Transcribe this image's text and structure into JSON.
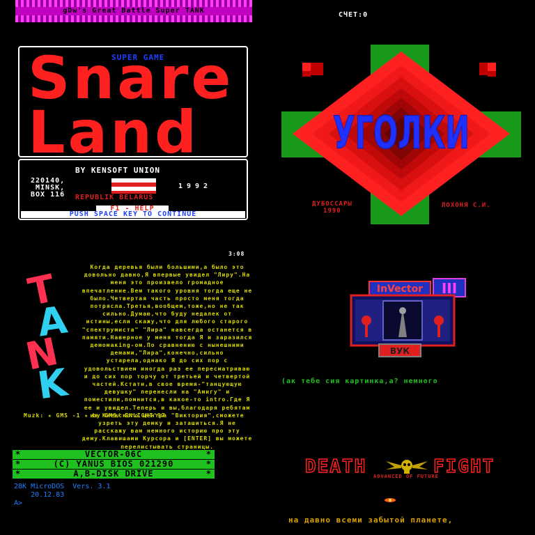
{
  "panel1": {
    "strip_title": "gDw's Great Battle Super TANK",
    "score": "СЧЕТ:0"
  },
  "snare": {
    "super_game": "SUPER GAME",
    "title_line1": "Snare",
    "title_line2": "Land",
    "by": "BY KENSOFT UNION",
    "address": "220140,\n MINSK,\nBOX 116",
    "year": "1992",
    "republic": "REPUBLIK BELARUS",
    "help": "F1 - HELP",
    "push": "PUSH SPACE KEY TO CONTINUE"
  },
  "ugolki": {
    "title": "УГОЛКИ",
    "city": "ДУБОССАРЫ\n1990",
    "author": "ЛОХОНЯ С.И.",
    "colors": {
      "red": "#ff2020",
      "green": "#1a9a1a",
      "blue": "#2030ff"
    }
  },
  "tank": {
    "time": "3:08",
    "logo_letters": [
      "T",
      "A",
      "N",
      "K"
    ],
    "text": "Когда деревья были большими,а было это довольно давно,Я впервые увидел \"Лиру\".На меня это произвело громадное впечатление.Вем такого уровня тогда еще не было.Четвертая часть просто меня тогда потрясла.Третья,вообщем,тоже,но не так сильно.Думаю,что буду недалек от истины,если скажу,что для любого старого \"спектрумиста\" \"Лира\" навсегда останется в памяти.Наверное у меня тогда Я и заразился демомакing-ом.По сравнению с нынешними демами,\"Лира\",конечно,сильно устарела,однако Я до сих пор с удовольствием иногда раз ее пересматриваю и до сих пор торчу от третьей и четвертой частей.Кстати,в свое время-\"танцующую девушку\" перенесли на \"Амигу\" и поместили,помнится,в какое-то intro.Где Я ее и увидел.Теперь и вы,благодаря ребятам из Киевского центра \"Виктория\",сможете узреть эту демку и заташиться.Я не расскажу вам немного историю про эту дему.Клавишами Курсора и [ENTER] вы можете перелистывать страницы.",
    "music": "Muzk:  ★ GMS -1 ★ by GMS/ ENLIGHT'97"
  },
  "invector": {
    "title": "InVector",
    "number": "III",
    "signature": "ВУК",
    "caption": "(ак тебе сия картинка,а? немного"
  },
  "vector": {
    "rows": [
      {
        "left": "*",
        "center": "VECTOR-06C",
        "right": "*"
      },
      {
        "left": "*",
        "center": "(C) YANUS BIOS 021290",
        "right": "*"
      },
      {
        "left": "*",
        "center": "A,B-DISK DRIVE",
        "right": "*"
      }
    ],
    "os": "28K MicroDOS  Vers. 3.1\n    20.12.83\nA>"
  },
  "deathfight": {
    "title_left": "DEATH",
    "title_right": "FIGHT",
    "subtitle": "ADVANCED OF FUTURE",
    "line": "на давно всеми забытой планете,"
  }
}
